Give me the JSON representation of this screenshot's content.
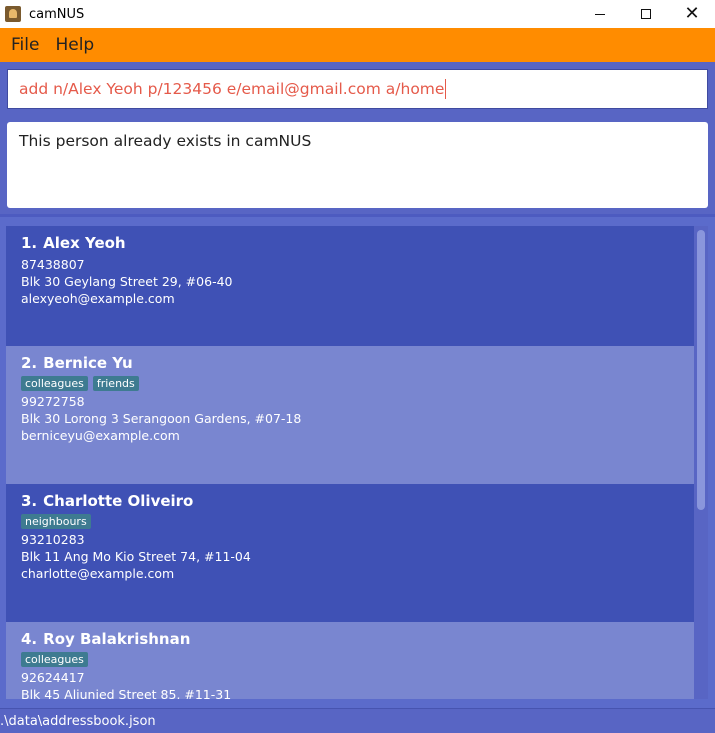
{
  "window": {
    "title": "camNUS",
    "controls": {
      "minimize": "minimize-icon",
      "maximize": "maximize-icon",
      "close": "close-icon"
    }
  },
  "menubar": {
    "items": [
      {
        "label": "File"
      },
      {
        "label": "Help"
      }
    ]
  },
  "command_box": {
    "value": "add n/Alex Yeoh p/123456 e/email@gmail.com a/home"
  },
  "result_display": {
    "text": "This person already exists in camNUS"
  },
  "persons": [
    {
      "index": "1.",
      "name": "Alex Yeoh",
      "tags": [],
      "phone": "87438807",
      "address": "Blk 30 Geylang Street 29, #06-40",
      "email": "alexyeoh@example.com"
    },
    {
      "index": "2.",
      "name": "Bernice Yu",
      "tags": [
        "colleagues",
        "friends"
      ],
      "phone": "99272758",
      "address": "Blk 30 Lorong 3 Serangoon Gardens, #07-18",
      "email": "berniceyu@example.com"
    },
    {
      "index": "3.",
      "name": "Charlotte Oliveiro",
      "tags": [
        "neighbours"
      ],
      "phone": "93210283",
      "address": "Blk 11 Ang Mo Kio Street 74, #11-04",
      "email": "charlotte@example.com"
    },
    {
      "index": "4.",
      "name": "Roy Balakrishnan",
      "tags": [
        "colleagues"
      ],
      "phone": "92624417",
      "address": "Blk 45 Aljunied Street 85, #11-31",
      "email": ""
    }
  ],
  "status_bar": {
    "path": ".\\data\\addressbook.json"
  },
  "colors": {
    "menubar": "#ff8c00",
    "card_dark": "#3f51b5",
    "card_light": "#7986d0",
    "tag": "#3e7b91",
    "command_text": "#e55a4a"
  }
}
